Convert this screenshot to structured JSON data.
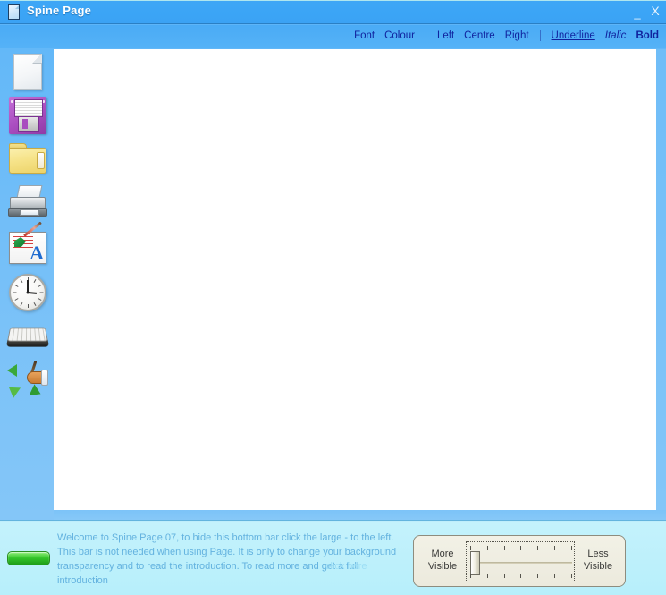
{
  "window": {
    "title": "Spine Page",
    "icon": "page-icon",
    "minimize_label": "_",
    "close_label": "X"
  },
  "format_toolbar": {
    "items": [
      {
        "label": "Font",
        "name": "font",
        "style": "normal"
      },
      {
        "label": "Colour",
        "name": "colour",
        "style": "normal"
      },
      {
        "label": "Left",
        "name": "align-left",
        "style": "normal"
      },
      {
        "label": "Centre",
        "name": "align-centre",
        "style": "normal"
      },
      {
        "label": "Right",
        "name": "align-right",
        "style": "normal"
      },
      {
        "label": "Underline",
        "name": "underline",
        "style": "underline"
      },
      {
        "label": "Italic",
        "name": "italic",
        "style": "italic"
      },
      {
        "label": "Bold",
        "name": "bold",
        "style": "bold"
      }
    ]
  },
  "sidebar": {
    "items": [
      {
        "name": "new-document",
        "icon": "document-icon"
      },
      {
        "name": "save",
        "icon": "floppy-disk-icon"
      },
      {
        "name": "open-folder",
        "icon": "folder-icon"
      },
      {
        "name": "print",
        "icon": "printer-icon"
      },
      {
        "name": "font-format",
        "icon": "font-format-icon"
      },
      {
        "name": "clock",
        "icon": "clock-icon"
      },
      {
        "name": "keyboard",
        "icon": "keyboard-icon"
      },
      {
        "name": "write",
        "icon": "writing-hand-icon"
      }
    ]
  },
  "editor": {
    "content": ""
  },
  "bottom_bar": {
    "toggle_name": "visibility-toggle",
    "welcome_text": "Welcome to Spine Page 07, to hide this bottom bar click the large - to the left.  This bar is not needed when using  Page.  It is only to change your background transparency and to read the introduction.  To read more and get a full introduction",
    "click_here_text": "click here",
    "slider": {
      "left_label": "More Visible",
      "right_label": "Less Visible",
      "value": 0,
      "min": 0,
      "max": 100,
      "tick_count": 7
    }
  },
  "colors": {
    "title_bar": "#3ba5f6",
    "app_background": "#76c0f7",
    "canvas": "#ffffff",
    "bottom_panel": "#bdf0fb",
    "toolbar_text": "#10239e",
    "welcome_text": "#63b2df",
    "toggle_green": "#34c52a"
  }
}
